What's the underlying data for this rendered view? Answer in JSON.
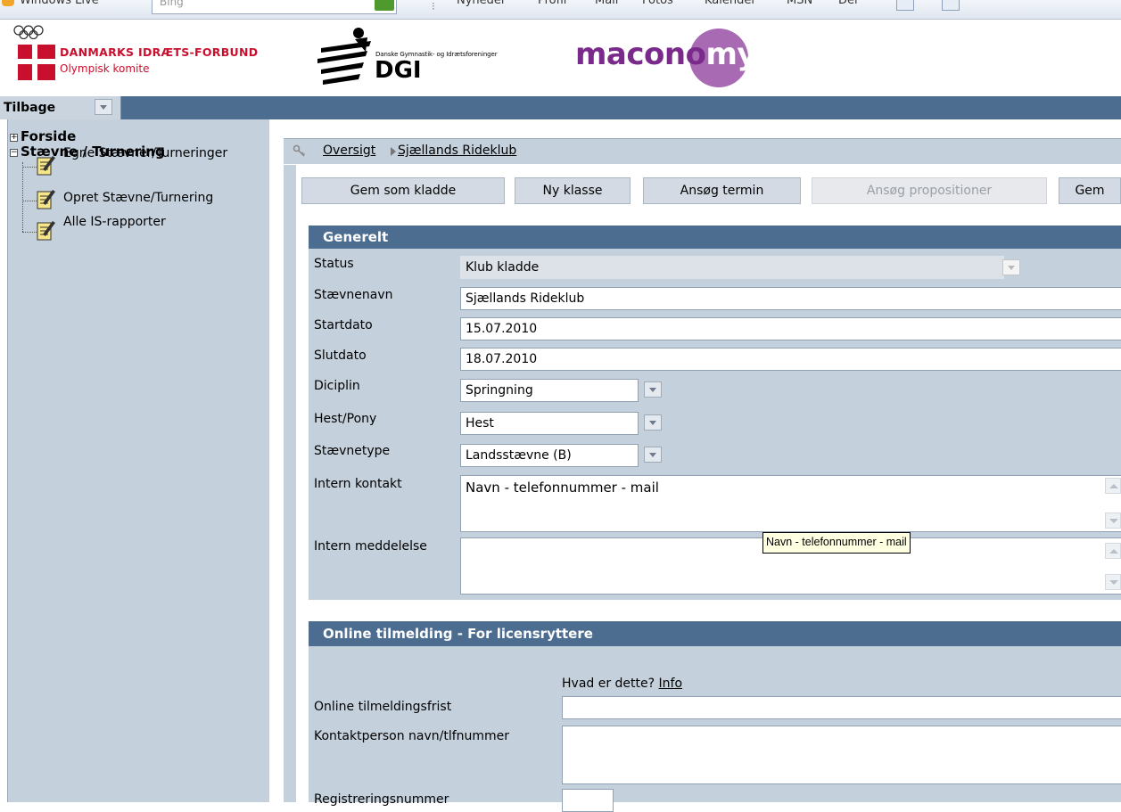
{
  "browser": {
    "windows_live": "Windows Live",
    "search_placeholder": "Bing",
    "menu_items": [
      "Nyheder",
      "Profil",
      "Mail",
      "Fotos",
      "Kalender",
      "MSN",
      "Del"
    ]
  },
  "header": {
    "dif_name": "DANMARKS IDRÆTS-FORBUND",
    "dif_sub": "Olympisk komite",
    "dgi_sub": "Danske Gymnastik- og Idrætsforeninger",
    "dgi_name": "DGI",
    "maconomy_main": "macono",
    "maconomy_end": "my"
  },
  "nav": {
    "back_label": "Tilbage"
  },
  "sidebar": {
    "forside": "Forside",
    "staevne": "Stævne / Turnering",
    "items": [
      {
        "label": "Egne Stævner/Turneringer"
      },
      {
        "label": "Opret Stævne/Turnering"
      },
      {
        "label": "Alle IS-rapporter"
      }
    ]
  },
  "breadcrumb": {
    "overview": "Oversigt",
    "current": "Sjællands Rideklub"
  },
  "toolbar": {
    "save_draft": "Gem som kladde",
    "new_class": "Ny klasse",
    "apply_term": "Ansøg termin",
    "apply_props": "Ansøg propositioner",
    "save": "Gem"
  },
  "general": {
    "title": "Generelt",
    "status_label": "Status",
    "status_value": "Klub kladde",
    "name_label": "Stævnenavn",
    "name_value": "Sjællands Rideklub",
    "start_label": "Startdato",
    "start_value": "15.07.2010",
    "end_label": "Slutdato",
    "end_value": "18.07.2010",
    "discipline_label": "Diciplin",
    "discipline_value": "Springning",
    "horse_label": "Hest/Pony",
    "horse_value": "Hest",
    "type_label": "Stævnetype",
    "type_value": "Landsstævne (B)",
    "contact_label": "Intern kontakt",
    "contact_value": "Navn - telefonnummer - mail",
    "message_label": "Intern meddelelse",
    "message_value": ""
  },
  "tooltip": {
    "text": "Navn - telefonnummer - mail"
  },
  "online": {
    "title": "Online tilmelding - For licensryttere",
    "whatis": "Hvad er dette?",
    "info": "Info",
    "deadline_label": "Online tilmeldingsfrist",
    "contact_label": "Kontaktperson navn/tlfnummer",
    "reg_label": "Registreringsnummer"
  }
}
